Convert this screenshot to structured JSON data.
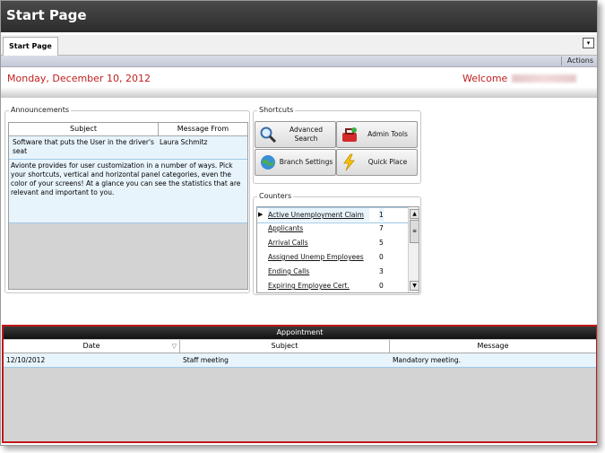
{
  "window": {
    "title": "Start Page"
  },
  "tabs": [
    {
      "label": "Start Page"
    }
  ],
  "actions": {
    "label": "Actions"
  },
  "datebar": {
    "date": "Monday, December 10, 2012",
    "welcome": "Welcome"
  },
  "announcements": {
    "legend": "Announcements",
    "columns": [
      "Subject",
      "Message From"
    ],
    "rows": [
      {
        "subject": "Software that puts the User in the driver's seat",
        "from": "Laura Schmitz",
        "body": "Avionte provides for user customization in a number of ways.  Pick your shortcuts, vertical and horizontal panel categories, even the color of your screens!  At a glance you can see the statistics that are relevant and important  to you."
      }
    ]
  },
  "shortcuts": {
    "legend": "Shortcuts",
    "items": [
      {
        "label": "Advanced Search",
        "icon": "magnifier-icon"
      },
      {
        "label": "Admin Tools",
        "icon": "toolbox-icon"
      },
      {
        "label": "Branch Settings",
        "icon": "globe-icon"
      },
      {
        "label": "Quick Place",
        "icon": "lightning-icon"
      }
    ]
  },
  "counters": {
    "legend": "Counters",
    "items": [
      {
        "name": "Active Unemployment Claim",
        "value": "1"
      },
      {
        "name": "Applicants",
        "value": "7"
      },
      {
        "name": "Arrival Calls",
        "value": "5"
      },
      {
        "name": "Assigned Unemp Employees",
        "value": "0"
      },
      {
        "name": "Ending Calls",
        "value": "3"
      },
      {
        "name": "Expiring Employee Cert.",
        "value": "0"
      }
    ]
  },
  "appointment": {
    "title": "Appointment",
    "columns": [
      "Date",
      "Subject",
      "Message"
    ],
    "rows": [
      {
        "date": "12/10/2012",
        "subject": "Staff meeting",
        "message": "Mandatory meeting."
      }
    ]
  },
  "colors": {
    "accent_red": "#c02020",
    "selection": "#e8f4fc"
  }
}
